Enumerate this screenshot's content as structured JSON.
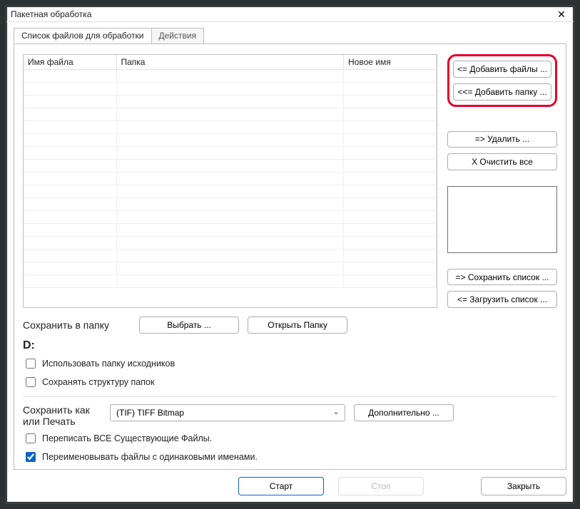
{
  "window": {
    "title": "Пакетная обработка",
    "close_glyph": "✕"
  },
  "tabs": {
    "filelist": "Список файлов для обработки",
    "actions": "Действия"
  },
  "table": {
    "col_name": "Имя файла",
    "col_folder": "Папка",
    "col_new": "Новое имя",
    "rows": 17
  },
  "side_buttons": {
    "add_files": "<= Добавить файлы ...",
    "add_folder": "<<= Добавить папку ...",
    "remove": "=> Удалить ...",
    "clear": "X Очистить все",
    "save_list": "=> Сохранить список ...",
    "load_list": "<= Загрузить список ..."
  },
  "save_section": {
    "save_to_folder_label": "Сохранить в папку",
    "choose_btn": "Выбрать ...",
    "open_folder_btn": "Открыть Папку",
    "drive_label": "D:",
    "use_source_folder": "Использовать папку исходников",
    "keep_structure": "Сохранять структуру папок"
  },
  "saveas_section": {
    "label_line1": "Сохранить как",
    "label_line2": "или Печать",
    "format_selected": "(TIF) TIFF Bitmap",
    "extra_btn": "Дополнительно ...",
    "overwrite": "Переписать ВСЕ Существующие Файлы.",
    "rename_dupes": "Переименовывать файлы с одинаковыми именами."
  },
  "footer": {
    "start": "Старт",
    "stop": "Стоп",
    "close": "Закрыть"
  }
}
